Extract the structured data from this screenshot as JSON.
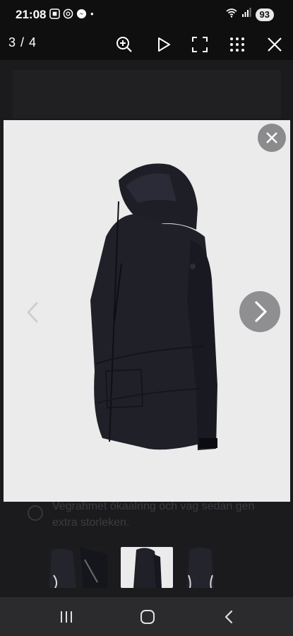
{
  "status_bar": {
    "time": "21:08",
    "dot": "•",
    "battery": "93",
    "icons_left": [
      "screenshot-icon",
      "threads-icon",
      "messenger-icon"
    ],
    "icons_right": [
      "wifi-icon",
      "signal-icon"
    ]
  },
  "viewer": {
    "counter": "3 / 4",
    "actions": [
      "zoom-in-icon",
      "play-icon",
      "fullscreen-icon",
      "grid-icon",
      "close-icon"
    ]
  },
  "background_page": {
    "text": "Vegrahmet ökaalring och vag sedan gen extra storleken."
  },
  "thumbnails": [
    {
      "name": "thumb-1",
      "selected": false
    },
    {
      "name": "thumb-2",
      "selected": true
    },
    {
      "name": "thumb-3",
      "selected": false
    }
  ],
  "colors": {
    "panel": "#ebebec",
    "jacket": "#1f2028",
    "overlay": "#1b1b1d"
  }
}
